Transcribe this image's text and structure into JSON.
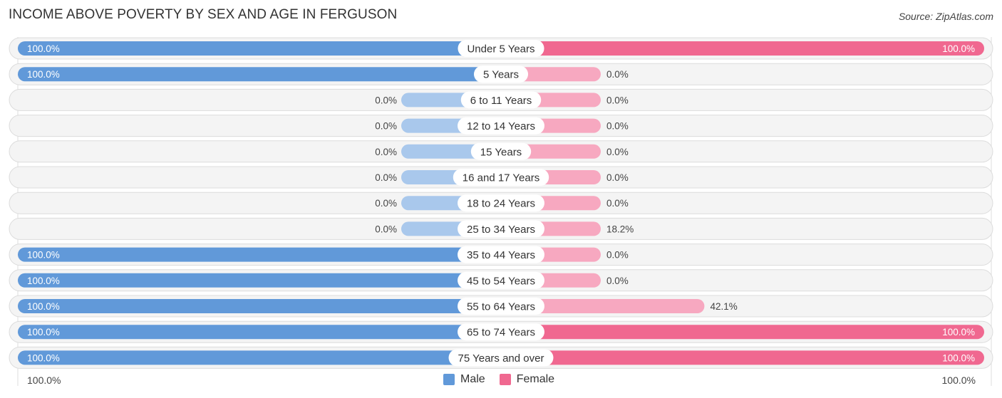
{
  "header": {
    "title": "INCOME ABOVE POVERTY BY SEX AND AGE IN FERGUSON",
    "source": "Source: ZipAtlas.com"
  },
  "colors": {
    "male": "#6199d9",
    "male_light": "#a9c8ec",
    "female": "#f06890",
    "female_light": "#f7a8c0",
    "row_bg": "#f4f4f4"
  },
  "chart_data": {
    "type": "bar",
    "orientation": "horizontal-diverging",
    "title": "INCOME ABOVE POVERTY BY SEX AND AGE IN FERGUSON",
    "categories": [
      "Under 5 Years",
      "5 Years",
      "6 to 11 Years",
      "12 to 14 Years",
      "15 Years",
      "16 and 17 Years",
      "18 to 24 Years",
      "25 to 34 Years",
      "35 to 44 Years",
      "45 to 54 Years",
      "55 to 64 Years",
      "65 to 74 Years",
      "75 Years and over"
    ],
    "series": [
      {
        "name": "Male",
        "values": [
          100.0,
          100.0,
          0.0,
          0.0,
          0.0,
          0.0,
          0.0,
          0.0,
          100.0,
          100.0,
          100.0,
          100.0,
          100.0
        ]
      },
      {
        "name": "Female",
        "values": [
          100.0,
          0.0,
          0.0,
          0.0,
          0.0,
          0.0,
          0.0,
          18.2,
          0.0,
          0.0,
          42.1,
          100.0,
          100.0
        ]
      }
    ],
    "value_labels": {
      "Male": [
        "100.0%",
        "100.0%",
        "0.0%",
        "0.0%",
        "0.0%",
        "0.0%",
        "0.0%",
        "0.0%",
        "100.0%",
        "100.0%",
        "100.0%",
        "100.0%",
        "100.0%"
      ],
      "Female": [
        "100.0%",
        "0.0%",
        "0.0%",
        "0.0%",
        "0.0%",
        "0.0%",
        "0.0%",
        "18.2%",
        "0.0%",
        "0.0%",
        "42.1%",
        "100.0%",
        "100.0%"
      ]
    },
    "xlim": [
      0,
      100
    ],
    "axis_labels": {
      "left": "100.0%",
      "right": "100.0%"
    },
    "legend": {
      "position": "bottom-center",
      "entries": [
        "Male",
        "Female"
      ]
    },
    "grid": false
  }
}
